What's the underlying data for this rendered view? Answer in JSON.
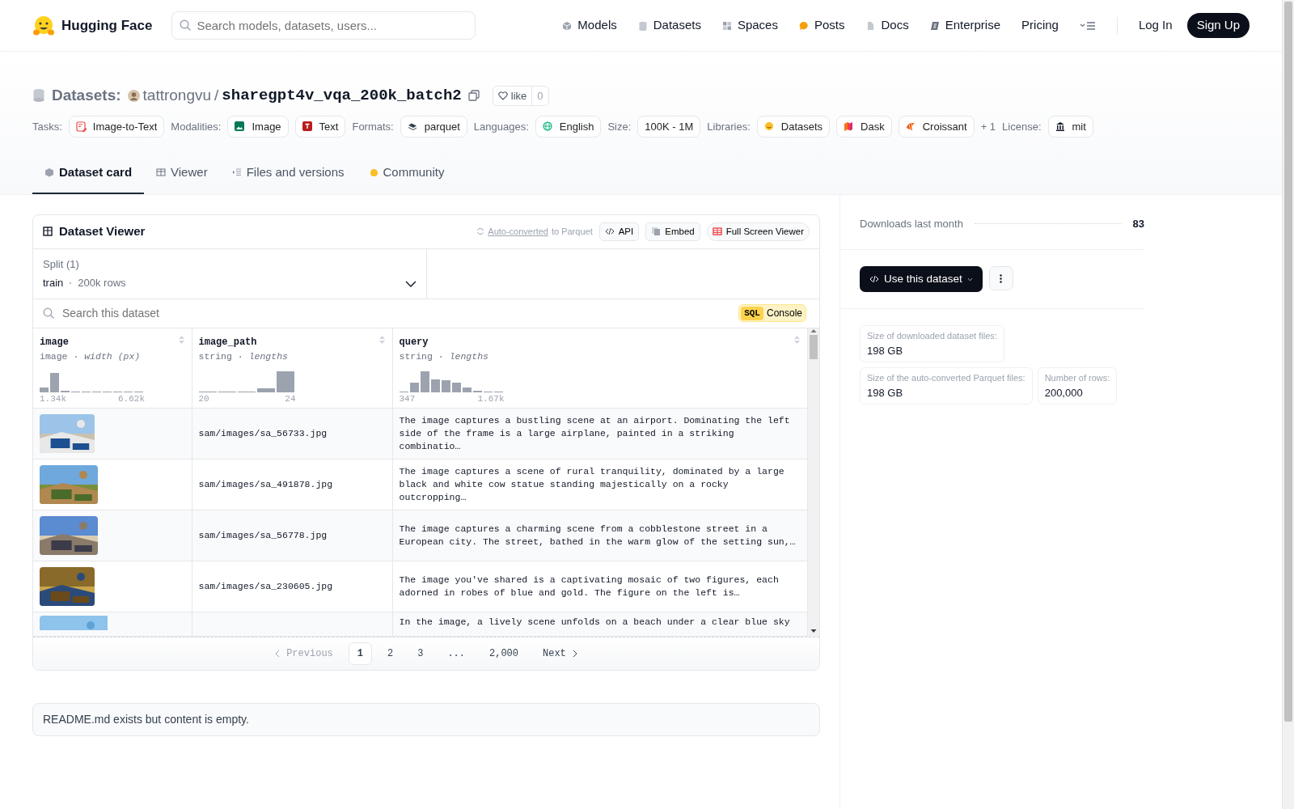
{
  "header": {
    "brand": "Hugging Face",
    "search": {
      "placeholder": "Search models, datasets, users..."
    },
    "nav": [
      {
        "label": "Models"
      },
      {
        "label": "Datasets"
      },
      {
        "label": "Spaces"
      },
      {
        "label": "Posts"
      },
      {
        "label": "Docs"
      },
      {
        "label": "Enterprise"
      },
      {
        "label": "Pricing"
      }
    ],
    "login": "Log In",
    "signup": "Sign Up"
  },
  "repo": {
    "section": "Datasets:",
    "owner": "tattrongvu",
    "separator": "/",
    "name": "sharegpt4v_vqa_200k_batch2",
    "like_label": "like",
    "like_count": "0"
  },
  "tags": [
    {
      "label": "Tasks:",
      "chips": [
        "Image-to-Text"
      ]
    },
    {
      "label": "Modalities:",
      "chips": [
        "Image",
        "Text"
      ]
    },
    {
      "label": "Formats:",
      "chips": [
        "parquet"
      ]
    },
    {
      "label": "Languages:",
      "chips": [
        "English"
      ]
    },
    {
      "label": "Size:",
      "chips": [
        "100K - 1M"
      ]
    },
    {
      "label": "Libraries:",
      "chips": [
        "Datasets",
        "Dask",
        "Croissant"
      ],
      "more": "+ 1"
    },
    {
      "label": "License:",
      "chips": [
        "mit"
      ]
    }
  ],
  "tabs": [
    {
      "label": "Dataset card",
      "selected": true
    },
    {
      "label": "Viewer",
      "selected": false
    },
    {
      "label": "Files and versions",
      "selected": false
    },
    {
      "label": "Community",
      "selected": false
    }
  ],
  "viewer": {
    "title": "Dataset Viewer",
    "auto_link": "Auto-converted",
    "auto_rest": "to Parquet",
    "buttons": [
      "API",
      "Embed",
      "Full Screen Viewer"
    ],
    "split_label": "Split (1)",
    "split_value": "train",
    "split_rows": "200k rows",
    "search": {
      "placeholder": "Search this dataset"
    },
    "sql_tag": "SQL",
    "sql_label": "Console",
    "columns": [
      {
        "name": "image",
        "type": "image · *width (px)*",
        "min": "1.34k",
        "max": "6.62k"
      },
      {
        "name": "image_path",
        "type": "string · *lengths*",
        "min": "20",
        "max": "24"
      },
      {
        "name": "query",
        "type": "string · *lengths*",
        "min": "347",
        "max": "1.67k"
      }
    ],
    "rows": [
      {
        "image_path": "sam/images/sa_56733.jpg",
        "query": "The image captures a bustling scene at an airport. Dominating the left side of the frame is a large airplane, painted in a striking combinatio…"
      },
      {
        "image_path": "sam/images/sa_491878.jpg",
        "query": "The image captures a scene of rural tranquility, dominated by a large black and white cow statue standing majestically on a rocky outcropping…"
      },
      {
        "image_path": "sam/images/sa_56778.jpg",
        "query": "The image captures a charming scene from a cobblestone street in a European city. The street, bathed in the warm glow of the setting sun,…"
      },
      {
        "image_path": "sam/images/sa_230605.jpg",
        "query": "The image you've shared is a captivating mosaic of two figures, each adorned in robes of blue and gold. The figure on the left is…"
      },
      {
        "image_path": "",
        "query": "In the image, a lively scene unfolds on a beach under a clear blue sky"
      }
    ],
    "pagination": {
      "previous": "Previous",
      "next": "Next",
      "pages": [
        {
          "label": "1",
          "selected": true
        },
        {
          "label": "2",
          "selected": false
        },
        {
          "label": "3",
          "selected": false
        },
        {
          "label": "...",
          "selected": false
        },
        {
          "label": "2,000",
          "selected": false
        }
      ]
    }
  },
  "readme": "README.md exists but content is empty.",
  "sidebar": {
    "downloads_label": "Downloads last month",
    "downloads": "83",
    "use_button": "Use this dataset",
    "stats": [
      {
        "label": "Size of downloaded dataset files:",
        "value": "198 GB"
      },
      {
        "label": "Size of the auto-converted Parquet files:",
        "value": "198 GB"
      },
      {
        "label": "Number of rows:",
        "value": "200,000"
      }
    ]
  }
}
